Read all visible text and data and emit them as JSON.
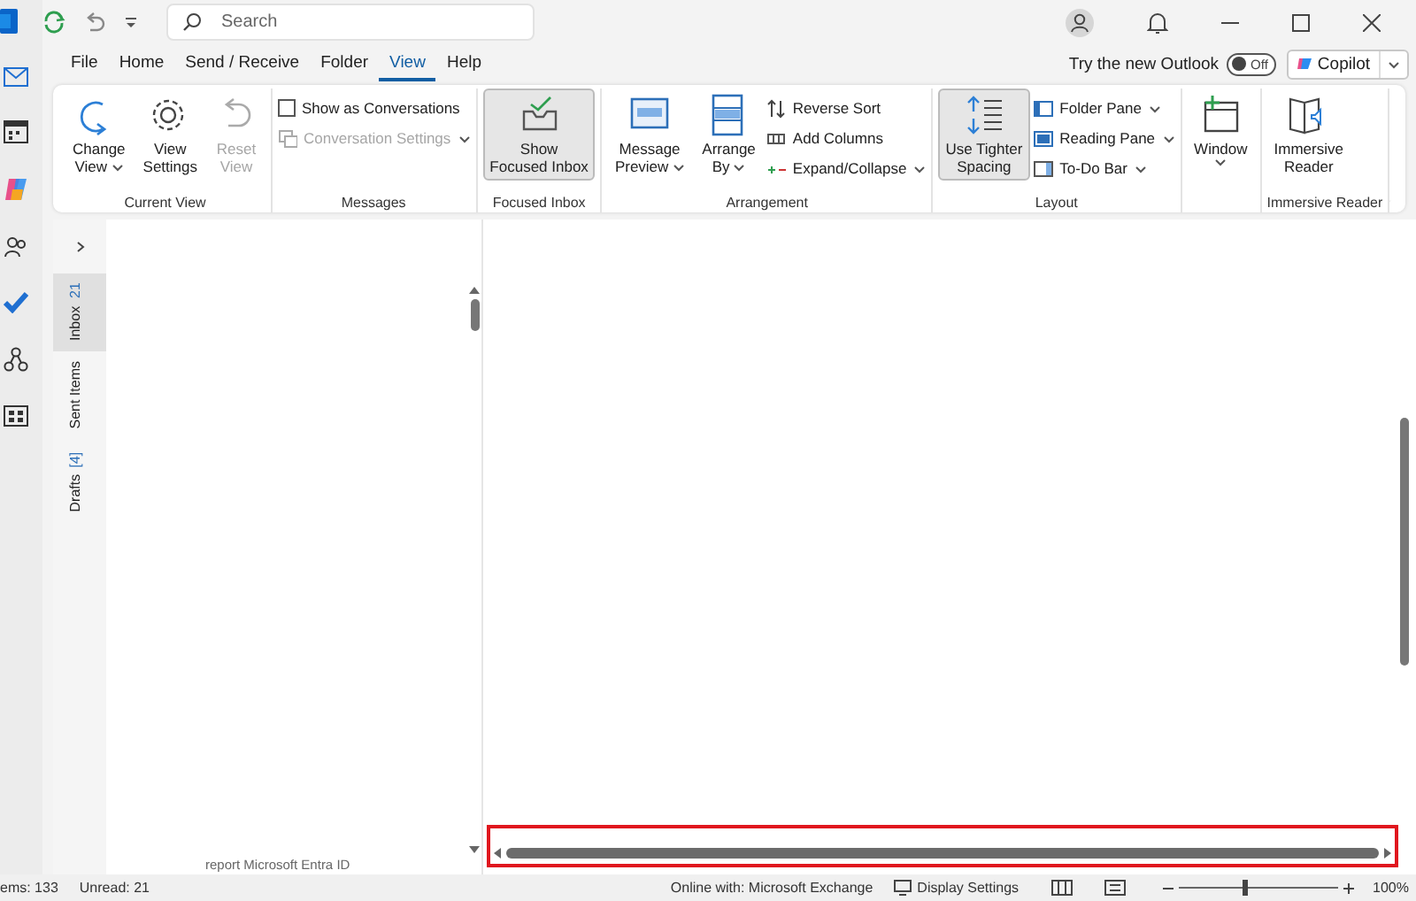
{
  "title_bar": {
    "search": {
      "placeholder": "Search"
    }
  },
  "menu_tabs": [
    {
      "label": "File",
      "selected": false
    },
    {
      "label": "Home",
      "selected": false
    },
    {
      "label": "Send / Receive",
      "selected": false
    },
    {
      "label": "Folder",
      "selected": false
    },
    {
      "label": "View",
      "selected": true
    },
    {
      "label": "Help",
      "selected": false
    }
  ],
  "try_new": {
    "label": "Try the new Outlook",
    "toggle": "Off",
    "on": false
  },
  "copilot": {
    "label": "Copilot"
  },
  "ribbon": [
    {
      "name": "Current View",
      "items": [
        {
          "kind": "large",
          "lines": [
            "Change",
            "View"
          ],
          "dropdown": true,
          "disabled": false,
          "selected": false
        },
        {
          "kind": "large",
          "lines": [
            "View",
            "Settings"
          ],
          "dropdown": false,
          "disabled": false,
          "selected": false
        },
        {
          "kind": "large",
          "lines": [
            "Reset",
            "View"
          ],
          "dropdown": false,
          "disabled": true,
          "selected": false
        }
      ]
    },
    {
      "name": "Messages",
      "items": [
        {
          "kind": "check",
          "label": "Show as Conversations",
          "checked": false
        },
        {
          "kind": "small",
          "label": "Conversation Settings",
          "dropdown": true,
          "disabled": true
        }
      ]
    },
    {
      "name": "Focused Inbox",
      "items": [
        {
          "kind": "large",
          "lines": [
            "Show",
            "Focused Inbox"
          ],
          "dropdown": false,
          "disabled": false,
          "selected": true
        }
      ]
    },
    {
      "name": "Arrangement",
      "items": [
        {
          "kind": "large",
          "lines": [
            "Message",
            "Preview"
          ],
          "dropdown": true,
          "disabled": false,
          "selected": false
        },
        {
          "kind": "large",
          "lines": [
            "Arrange",
            "By"
          ],
          "dropdown": true,
          "disabled": false,
          "selected": false
        },
        {
          "kind": "small",
          "label": "Reverse Sort",
          "dropdown": false,
          "disabled": false
        },
        {
          "kind": "small",
          "label": "Add Columns",
          "dropdown": false,
          "disabled": false
        },
        {
          "kind": "small",
          "label": "Expand/Collapse",
          "dropdown": true,
          "disabled": false
        }
      ]
    },
    {
      "name": "Layout",
      "items": [
        {
          "kind": "large",
          "lines": [
            "Use Tighter",
            "Spacing"
          ],
          "dropdown": false,
          "disabled": false,
          "selected": true
        },
        {
          "kind": "small",
          "label": "Folder Pane",
          "dropdown": true,
          "disabled": false
        },
        {
          "kind": "small",
          "label": "Reading Pane",
          "dropdown": true,
          "disabled": false
        },
        {
          "kind": "small",
          "label": "To-Do Bar",
          "dropdown": true,
          "disabled": false
        }
      ]
    },
    {
      "items": [
        {
          "kind": "large",
          "lines": [
            "Window"
          ],
          "dropdown": true,
          "disabled": false,
          "selected": false
        }
      ]
    },
    {
      "name": "Immersive Reader",
      "items": [
        {
          "kind": "large",
          "lines": [
            "Immersive",
            "Reader"
          ],
          "dropdown": false,
          "disabled": false,
          "selected": false
        }
      ]
    }
  ],
  "folder_tabs": [
    {
      "label": "Inbox",
      "count": "21",
      "selected": true
    },
    {
      "label": "Sent Items",
      "selected": false
    },
    {
      "label": "Drafts",
      "count": "[4]",
      "selected": false
    }
  ],
  "message_list": {
    "preview_text": "report  Microsoft Entra ID"
  },
  "status_bar": {
    "items": "ems: 133",
    "unread": "Unread: 21",
    "connection": "Online with: Microsoft Exchange",
    "display_settings": "Display Settings",
    "zoom": {
      "level": 0.42,
      "label": "100%"
    }
  }
}
